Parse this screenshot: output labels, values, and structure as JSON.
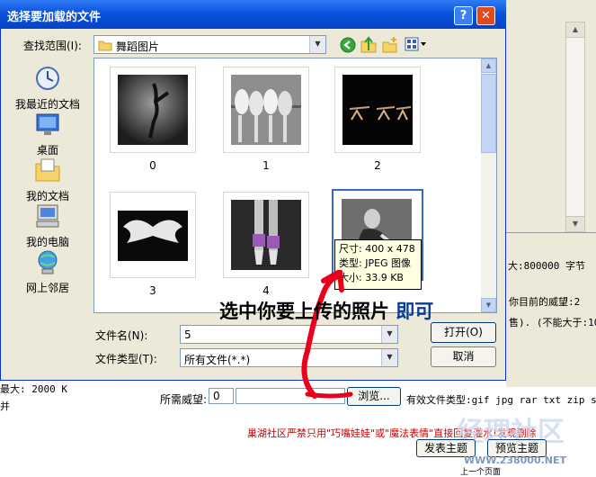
{
  "dialog": {
    "title": "选择要加载的文件",
    "help_btn": "?",
    "close_btn": "✕",
    "lookin_label": "查找范围(I):",
    "lookin_value": "舞蹈图片",
    "places": [
      {
        "label": "我最近的文档"
      },
      {
        "label": "桌面"
      },
      {
        "label": "我的文档"
      },
      {
        "label": "我的电脑"
      },
      {
        "label": "网上邻居"
      }
    ],
    "files": [
      {
        "name": "0"
      },
      {
        "name": "1"
      },
      {
        "name": "2"
      },
      {
        "name": "3"
      },
      {
        "name": "4"
      },
      {
        "name": "5"
      }
    ],
    "tooltip": {
      "size": "尺寸: 400 x 478",
      "type": "类型: JPEG 图像",
      "filesize": "大小: 33.9 KB"
    },
    "filename_label": "文件名(N):",
    "filename_value": "5",
    "filetype_label": "文件类型(T):",
    "filetype_value": "所有文件(*.*)",
    "open_btn": "打开(O)",
    "cancel_btn": "取消"
  },
  "annotation": {
    "text_main": "选中你要上传的照片",
    "text_blue": "即可"
  },
  "background": {
    "size_line": "大:800000 字节",
    "power_line": "你目前的威望:2",
    "limit_line": "售). (不能大于:10",
    "max_line": "最大: 2000 K",
    "row_mark": "并",
    "needed_label": "所需威望:",
    "needed_value": "0",
    "browse_btn": "浏览...",
    "filetypes": "有效文件类型:gif jpg rar txt zip sw",
    "notice": "巢湖社区严禁只用\"巧嘴娃娃\"或\"魔法表情\"直接回复灌水!发现删除",
    "publish_btn": "发表主题",
    "preview_btn": "预览主题",
    "watermark": "经理社区",
    "watermark_url": "WWW.238000.NET",
    "bottom_text": "上一个页面"
  },
  "colors": {
    "titlebar": "#0a52de",
    "annotation_arrow": "#e8001c",
    "red_text": "#cc0000"
  }
}
